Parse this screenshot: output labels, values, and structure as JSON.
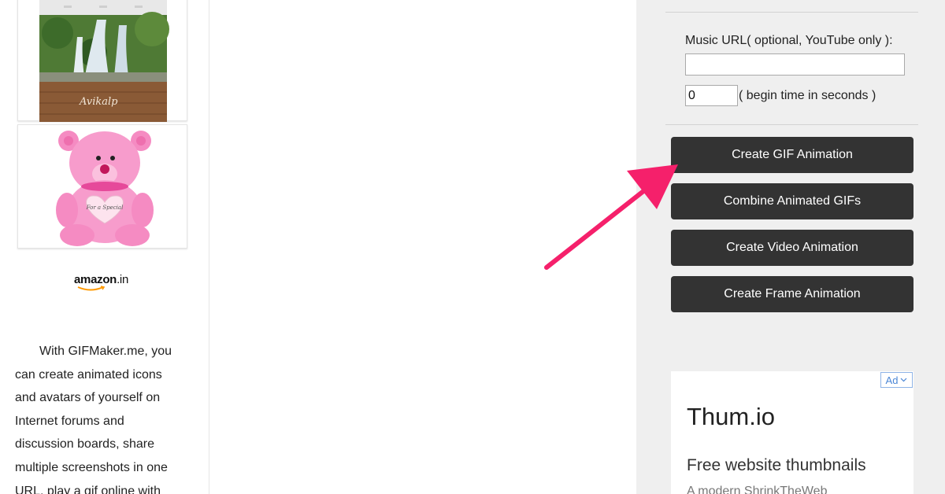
{
  "sidebar": {
    "poster_signature": "Avikalp",
    "bear_heart_text": "For a Special",
    "amazon_logo": {
      "brand": "amazon",
      "tld": ".in"
    },
    "intro_lines": [
      "With GIFMaker.me, you",
      "can create animated icons",
      "and avatars of yourself on",
      "Internet forums and",
      "discussion boards, share",
      "multiple screenshots in one",
      "URL, play a gif online with"
    ]
  },
  "music": {
    "label": "Music URL( optional, YouTube only ):",
    "url_value": "",
    "begin_time_value": "0",
    "begin_time_label": "( begin time in seconds )"
  },
  "actions": {
    "create_gif": "Create GIF Animation",
    "combine_gifs": "Combine Animated GIFs",
    "create_video": "Create Video Animation",
    "create_frame": "Create Frame Animation"
  },
  "ad": {
    "badge": "Ad",
    "title": "Thum.io",
    "subtitle": "Free website thumbnails",
    "description": "A modern ShrinkTheWeb"
  },
  "colors": {
    "button_bg": "#333333",
    "panel_bg": "#efefef",
    "arrow": "#f5206b",
    "ad_badge": "#4a86d6"
  }
}
